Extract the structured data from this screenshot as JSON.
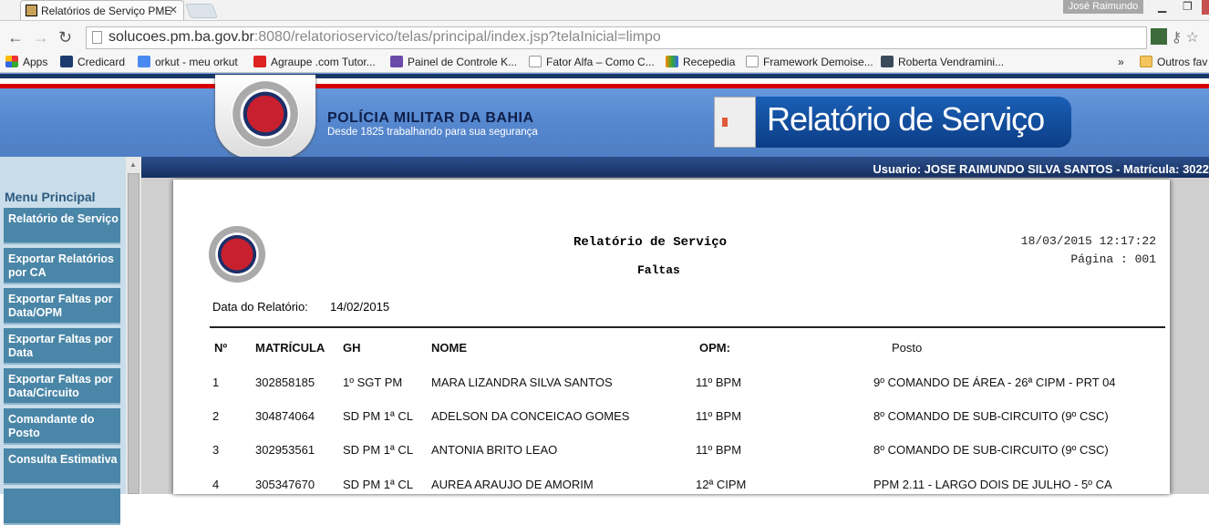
{
  "browser": {
    "tab_title": "Relatórios de Serviço PME",
    "window_user": "José Raimundo",
    "url_host": "solucoes.pm.ba.gov.br",
    "url_rest": ":8080/relatorioservico/telas/principal/index.jsp?telaInicial=limpo",
    "bookmarks": [
      "Apps",
      "Credicard",
      "orkut - meu orkut",
      "Agraupe .com Tutor...",
      "Painel de Controle K...",
      "Fator Alfa – Como C...",
      "Recepedia",
      "Framework Demoise...",
      "Roberta Vendramini..."
    ],
    "more": "»",
    "other_bookmarks": "Outros fav"
  },
  "banner": {
    "org": "POLÍCIA MILITAR DA BAHIA",
    "tagline": "Desde 1825 trabalhando para sua segurança",
    "app_logo": "Relatório de Serviço",
    "seal_text": "POLÍCIA MILITAR DA BAHIA"
  },
  "userbar": "Usuario: JOSE RAIMUNDO SILVA SANTOS - Matrícula: 3022",
  "sidebar": {
    "title": "Menu Principal",
    "items": [
      "Relatório de Serviço",
      "Exportar Relatórios por CA",
      "Exportar Faltas por Data/OPM",
      "Exportar Faltas por Data",
      "Exportar Faltas por Data/Circuito",
      "Comandante do Posto",
      "Consulta Estimativa"
    ]
  },
  "report": {
    "title": "Relatório de Serviço",
    "subtitle": "Faltas",
    "datetime": "18/03/2015 12:17:22",
    "page": "Página : 001",
    "date_label": "Data do Relatório:",
    "date_value": "14/02/2015",
    "columns": [
      "Nº",
      "MATRÍCULA",
      "GH",
      "NOME",
      "OPM:",
      "Posto"
    ],
    "rows": [
      [
        "1",
        "302858185",
        "1º SGT PM",
        "MARA LIZANDRA SILVA SANTOS",
        "11º BPM",
        "9º COMANDO DE ÁREA - 26ª CIPM - PRT 04"
      ],
      [
        "2",
        "304874064",
        "SD PM 1ª CL",
        "ADELSON DA CONCEICAO GOMES",
        "11º BPM",
        "8º COMANDO DE SUB-CIRCUITO (9º CSC)"
      ],
      [
        "3",
        "302953561",
        "SD PM 1ª CL",
        "ANTONIA BRITO LEAO",
        "11º BPM",
        "8º COMANDO DE SUB-CIRCUITO (9º CSC)"
      ],
      [
        "4",
        "305347670",
        "SD PM 1ª CL",
        "AUREA ARAUJO DE AMORIM",
        "12ª CIPM",
        "PPM 2.11 - LARGO DOIS DE JULHO - 5º CA"
      ]
    ]
  }
}
